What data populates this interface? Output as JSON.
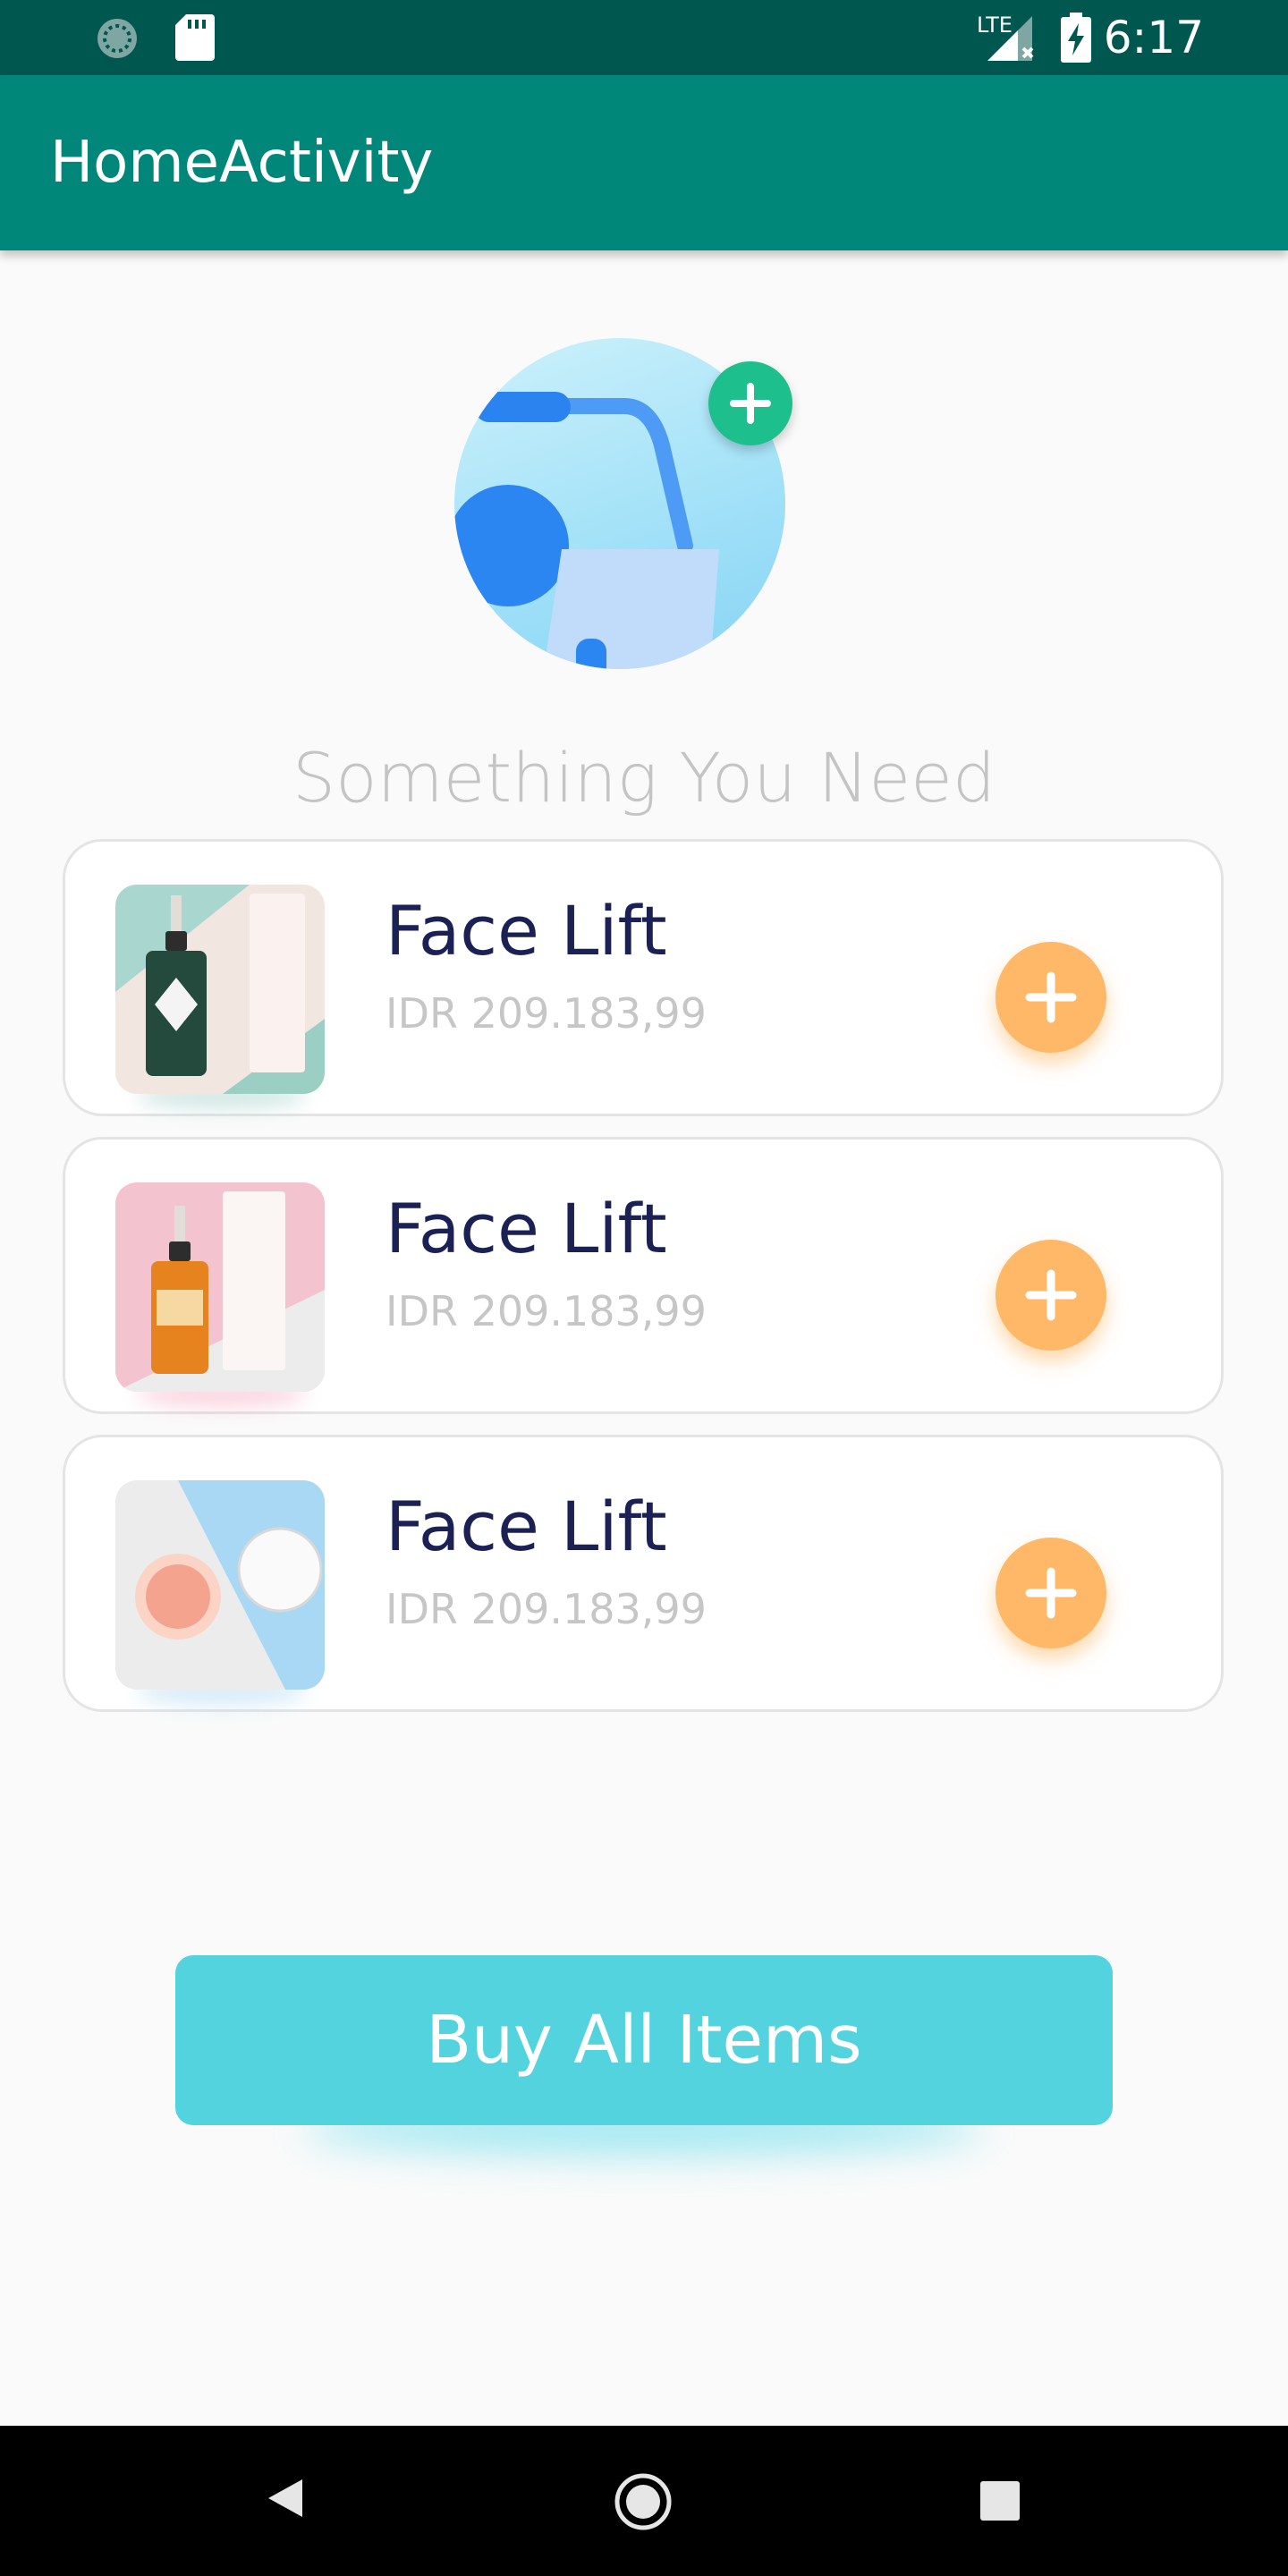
{
  "status_bar": {
    "time": "6:17",
    "network_label": "LTE",
    "icons": [
      "sync-icon",
      "sd-card-icon",
      "lte-signal-icon",
      "battery-charging-icon"
    ]
  },
  "app_bar": {
    "title": "HomeActivity"
  },
  "hero": {
    "add_icon": "plus-icon",
    "accent_color": "#1dbf8d"
  },
  "section": {
    "title": "Something You Need"
  },
  "products": [
    {
      "name": "Face Lift",
      "price": "IDR 209.183,99",
      "image": "serum-bottle-green"
    },
    {
      "name": "Face Lift",
      "price": "IDR 209.183,99",
      "image": "serum-bottle-amber"
    },
    {
      "name": "Face Lift",
      "price": "IDR 209.183,99",
      "image": "lip-scrub-jar"
    }
  ],
  "buy_button": {
    "label": "Buy All Items",
    "color": "#52d3de"
  },
  "colors": {
    "status_bar": "#00574f",
    "app_bar": "#00877a",
    "add_button": "#ffb867",
    "product_name": "#1b2154"
  },
  "nav": {
    "icons": [
      "back-icon",
      "home-icon",
      "recents-icon"
    ]
  }
}
